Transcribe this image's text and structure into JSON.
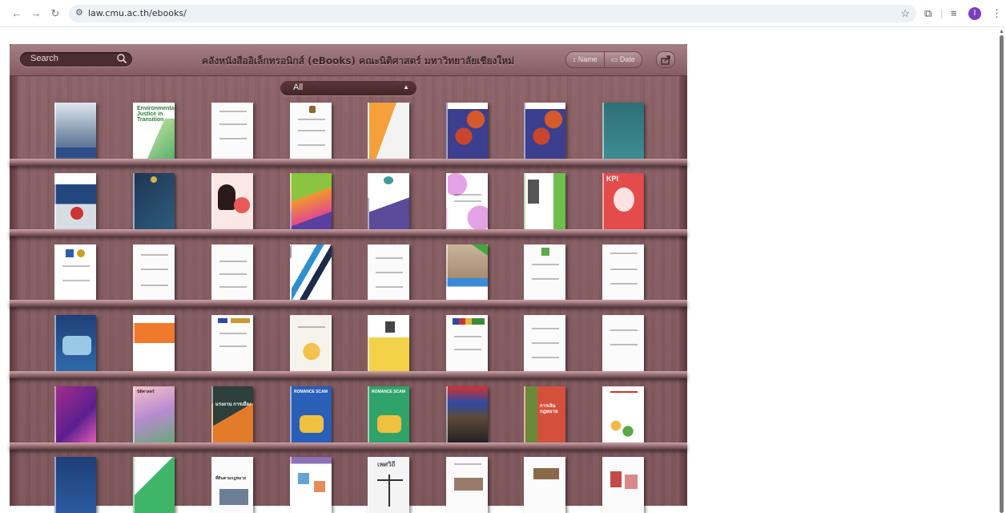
{
  "browser": {
    "url": "law.cmu.ac.th/ebooks/",
    "avatar_letter": "I"
  },
  "toolbar": {
    "search_label": "Search",
    "title": "คลังหนังสืออิเล็กทรอนิกส์ (eBooks) คณะนิติศาสตร์ มหาวิทยาลัยเชียงใหม่",
    "sort_name": "Name",
    "sort_date": "Date",
    "filter_value": "All"
  },
  "covers": {
    "book_1_2": "Environmental Justice in Transition",
    "book_3_8": "KPI",
    "book_5_2": "นิติศาสตร์",
    "book_5_3": "แรงงาน การเมือง",
    "book_5_4": "ROMANCE SCAM",
    "book_5_5": "ROMANCE SCAM",
    "book_5_7": "การเงิน กฎหมาย",
    "book_6_3": "ที่ดินตามกฎหมาย",
    "book_6_5": "เพศวิถี"
  }
}
